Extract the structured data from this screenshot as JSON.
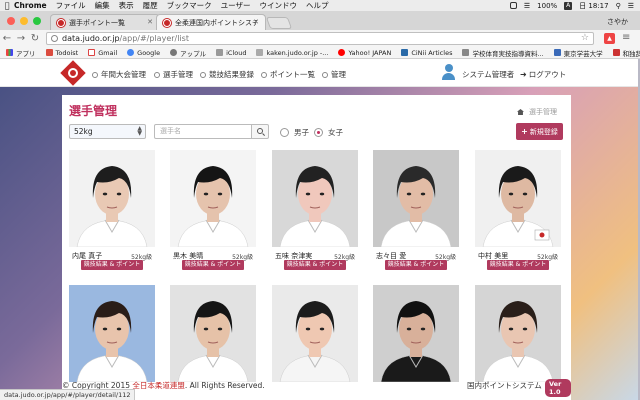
{
  "macos_menu": {
    "app": "Chrome",
    "items": [
      "ファイル",
      "編集",
      "表示",
      "履歴",
      "ブックマーク",
      "ユーザー",
      "ウインドウ",
      "ヘルプ"
    ],
    "battery": "100%",
    "input_indicator": "A",
    "clock": "日 18:17"
  },
  "browser": {
    "tabs": [
      {
        "title": "選手ポイント一覧",
        "active": false
      },
      {
        "title": "全柔連国内ポイントシステム",
        "active": true
      }
    ],
    "profile_name": "さやか",
    "url_host": "data.judo.or.jp",
    "url_path": "/app/#/player/list",
    "bookmarks": [
      "アプリ",
      "Todoist",
      "Gmail",
      "Google",
      "アップル",
      "iCloud",
      "kaken.judo.or.jp -...",
      "Yahoo! JAPAN",
      "CiNii Articles",
      "学校体育実技指導資料...",
      "東京学芸大学",
      "和独辞典"
    ],
    "status_url": "data.judo.or.jp/app/#/player/detail/112"
  },
  "site_nav": {
    "items": [
      "年間大会管理",
      "選手管理",
      "競技結果登録",
      "ポイント一覧",
      "管理"
    ],
    "admin_label": "システム管理者",
    "logout_label": "ログアウト"
  },
  "page": {
    "title": "選手管理",
    "breadcrumb": "選手管理",
    "weight_select": "52kg",
    "search_placeholder": "選手名",
    "gender_options": [
      {
        "label": "男子",
        "checked": false
      },
      {
        "label": "女子",
        "checked": true
      }
    ],
    "new_button": "新規登録",
    "card_button_label": "競技結果 & ポイント"
  },
  "players": [
    {
      "name": "内尾 真子",
      "weight_class": "52kg級"
    },
    {
      "name": "黒木 美晴",
      "weight_class": "52kg級"
    },
    {
      "name": "五味 奈津実",
      "weight_class": "52kg級"
    },
    {
      "name": "志々目 愛",
      "weight_class": "52kg級"
    },
    {
      "name": "中村 美里",
      "weight_class": "52kg級"
    },
    {
      "name": "",
      "weight_class": ""
    },
    {
      "name": "",
      "weight_class": ""
    },
    {
      "name": "",
      "weight_class": ""
    },
    {
      "name": "",
      "weight_class": ""
    },
    {
      "name": "",
      "weight_class": ""
    }
  ],
  "footer": {
    "copyright_prefix": "© Copyright 2015",
    "org": "全日本柔道連盟",
    "copyright_suffix": ". All Rights Reserved.",
    "system_name": "国内ポイントシステム",
    "version": "Ver 1.0"
  },
  "colors": {
    "accent": "#b03a5e",
    "title": "#c0305e",
    "logo_red": "#c62828"
  }
}
